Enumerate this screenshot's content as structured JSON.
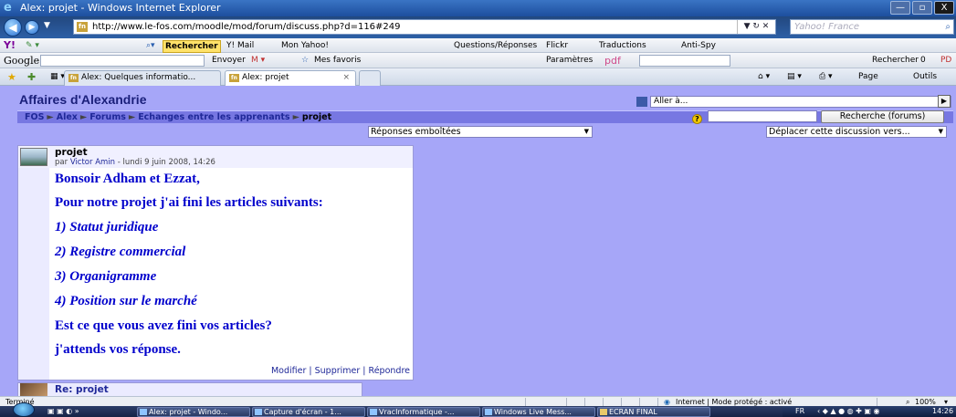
{
  "window": {
    "title": "Alex: projet - Windows Internet Explorer",
    "minimize": "—",
    "maximize": "▫",
    "close": "X"
  },
  "address_bar": {
    "url": "http://www.le-fos.com/moodle/mod/forum/discuss.php?d=116#249",
    "search_placeholder": "Yahoo! France"
  },
  "yahoo_toolbar": {
    "logo": "Y!",
    "search_button": "Rechercher",
    "items": [
      "Y! Mail",
      "Mon Yahoo!",
      "Questions/Réponses",
      "Flickr",
      "Traductions",
      "Anti-Spy"
    ]
  },
  "google_toolbar": {
    "logo": "Google",
    "send_to": "Envoyer",
    "favorites": "Mes favoris",
    "settings": "Paramètres",
    "pdf": "pdf",
    "search_right": "Rechercher",
    "count": "0",
    "pd": "PD"
  },
  "tabs": [
    {
      "label": "Alex: Quelques informatio..."
    },
    {
      "label": "Alex: projet"
    }
  ],
  "ie_commands": {
    "page": "Page",
    "tools": "Outils"
  },
  "moodle": {
    "course_title": "Affaires d'Alexandrie",
    "jump_label": "Aller à...",
    "breadcrumb": [
      "FOS",
      "Alex",
      "Forums",
      "Echanges entre les apprenants"
    ],
    "breadcrumb_current": "projet",
    "search_forum_button": "Recherche (forums)",
    "display_mode": "Réponses emboîtées",
    "move_discussion": "Déplacer cette discussion vers...",
    "post": {
      "subject": "projet",
      "byline_prefix": "par",
      "author": "Victor Amin",
      "date": "- lundi 9 juin 2008, 14:26",
      "lines": [
        "Bonsoir Adham et Ezzat,",
        "Pour notre projet j'ai fini les articles suivants:",
        "1) Statut juridique",
        "2) Registre commercial",
        "3) Organigramme",
        "4) Position sur le marché",
        "Est ce que vous avez fini vos articles?",
        "j'attends vos réponse."
      ],
      "commands": [
        "Modifier",
        "Supprimer",
        "Répondre"
      ]
    },
    "reply": {
      "subject": "Re: projet"
    }
  },
  "status_bar": {
    "left": "Terminé",
    "zone": "Internet | Mode protégé : activé",
    "zoom": "100%"
  },
  "taskbar": {
    "tasks": [
      "Alex: projet - Windo...",
      "Capture d'écran - 1...",
      "VracInformatique -...",
      "Windows Live Mess...",
      "ECRAN FINAL"
    ],
    "lang": "FR",
    "time": "14:26"
  }
}
